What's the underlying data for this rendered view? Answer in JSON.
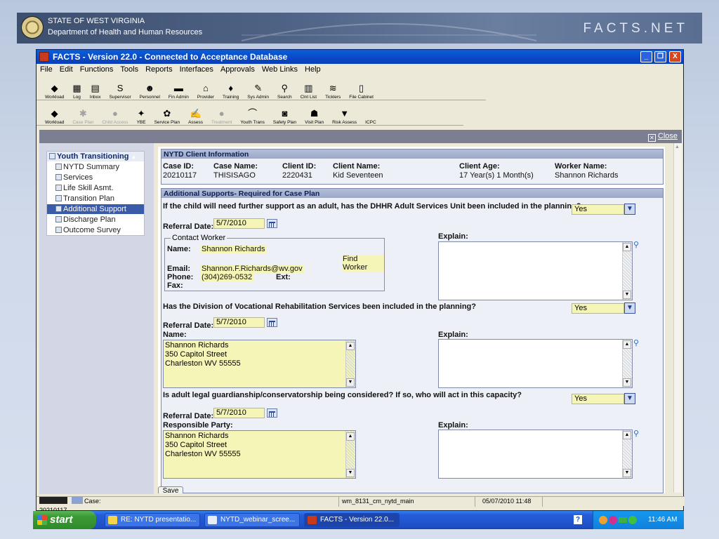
{
  "banner": {
    "line1": "STATE OF WEST VIRGINIA",
    "line2": "Department of Health and Human Resources",
    "brand": "FACTS.NET"
  },
  "window": {
    "title": "FACTS - Version 22.0 - Connected to Acceptance Database",
    "min": "_",
    "max": "❐",
    "close": "X"
  },
  "menu": [
    "File",
    "Edit",
    "Functions",
    "Tools",
    "Reports",
    "Interfaces",
    "Approvals",
    "Web Links",
    "Help"
  ],
  "toolbar1": [
    {
      "label": "Workload",
      "icon": "workload-icon",
      "glyph": "◆"
    },
    {
      "label": "Log",
      "icon": "log-icon",
      "glyph": "▦"
    },
    {
      "label": "Inbox",
      "icon": "inbox-icon",
      "glyph": "▤"
    },
    {
      "label": "Supervisor",
      "icon": "supervisor-icon",
      "glyph": "S"
    },
    {
      "label": "Personnel",
      "icon": "personnel-icon",
      "glyph": "☻"
    },
    {
      "label": "Fin Admin",
      "icon": "fin-admin-icon",
      "glyph": "▬"
    },
    {
      "label": "Provider",
      "icon": "provider-icon",
      "glyph": "⌂"
    },
    {
      "label": "Training",
      "icon": "training-icon",
      "glyph": "♦"
    },
    {
      "label": "Sys Admin",
      "icon": "sys-admin-icon",
      "glyph": "✎"
    },
    {
      "label": "Search",
      "icon": "search-icon",
      "glyph": "⚲"
    },
    {
      "label": "Clnt List",
      "icon": "client-list-icon",
      "glyph": "▥"
    },
    {
      "label": "Ticklers",
      "icon": "ticklers-icon",
      "glyph": "≋"
    },
    {
      "label": "File Cabinet",
      "icon": "file-cabinet-icon",
      "glyph": "▯"
    }
  ],
  "toolbar2": [
    {
      "label": "Workload",
      "icon": "workload-icon",
      "glyph": "◆",
      "disabled": false
    },
    {
      "label": "Case Plan",
      "icon": "case-plan-icon",
      "glyph": "✱",
      "disabled": true
    },
    {
      "label": "Child Access",
      "icon": "child-access-icon",
      "glyph": "●",
      "disabled": true
    },
    {
      "label": "YBE",
      "icon": "ybe-icon",
      "glyph": "✦",
      "disabled": false
    },
    {
      "label": "Service Plan",
      "icon": "service-plan-icon",
      "glyph": "✿",
      "disabled": false
    },
    {
      "label": "Assess",
      "icon": "assess-icon",
      "glyph": "✍",
      "disabled": false
    },
    {
      "label": "Treatment",
      "icon": "treatment-icon",
      "glyph": "●",
      "disabled": true
    },
    {
      "label": "Youth Trans",
      "icon": "youth-trans-icon",
      "glyph": "⌒",
      "disabled": false
    },
    {
      "label": "Safety Plan",
      "icon": "safety-plan-icon",
      "glyph": "◙",
      "disabled": false
    },
    {
      "label": "Visit Plan",
      "icon": "visit-plan-icon",
      "glyph": "☗",
      "disabled": false
    },
    {
      "label": "Risk Assess",
      "icon": "risk-assess-icon",
      "glyph": "▼",
      "disabled": false
    },
    {
      "label": "ICPC",
      "icon": "icpc-icon",
      "glyph": "",
      "disabled": false
    }
  ],
  "close_label": "Close",
  "tree": {
    "root": "Youth Transitioning",
    "items": [
      "NYTD Summary",
      "Services",
      "Life Skill Asmt.",
      "Transition Plan",
      "Additional Support",
      "Discharge Plan",
      "Outcome Survey"
    ],
    "selected_index": 4
  },
  "client_info": {
    "header": "NYTD Client Information",
    "case_id_label": "Case ID:",
    "case_id": "20210117",
    "case_name_label": "Case Name:",
    "case_name": "THISISAGO",
    "client_id_label": "Client ID:",
    "client_id": "2220431",
    "client_name_label": "Client Name:",
    "client_name": "Kid Seventeen",
    "client_age_label": "Client Age:",
    "client_age": "17 Year(s) 1 Month(s)",
    "worker_name_label": "Worker Name:",
    "worker_name": "Shannon Richards"
  },
  "supports": {
    "header": "Additional Supports- Required for Case Plan",
    "q1": "If the child will need further support as an adult, has the DHHR Adult Services Unit been included in the planning?",
    "q1_answer": "Yes",
    "referral_label": "Referral Date:",
    "q1_referral_date": "5/7/2010",
    "contact_legend": "Contact Worker",
    "name_label": "Name:",
    "contact_name": "Shannon Richards",
    "find_worker": "Find Worker",
    "email_label": "Email:",
    "contact_email": "Shannon.F.Richards@wv.gov",
    "phone_label": "Phone:",
    "contact_phone": "(304)269-0532",
    "ext_label": "Ext:",
    "fax_label": "Fax:",
    "explain_label": "Explain:",
    "q2": "Has the Division of Vocational Rehabilitation Services been included in the planning?",
    "q2_answer": "Yes",
    "q2_referral_date": "5/7/2010",
    "q2_name_label": "Name:",
    "q2_name_lines": [
      "Shannon Richards",
      "350 Capitol Street",
      "Charleston WV 55555"
    ],
    "q3": "Is adult legal guardianship/conservatorship being considered? If so, who will act in this capacity?",
    "q3_answer": "Yes",
    "q3_referral_date": "5/7/2010",
    "responsible_label": "Responsible Party:",
    "q3_party_lines": [
      "Shannon Richards",
      "350 Capitol Street",
      "Charleston WV 55555"
    ],
    "save_label": "Save"
  },
  "status": {
    "case": "Case: 20210117",
    "form": "wm_8131_cm_nytd_main",
    "datetime": "05/07/2010 11:48"
  },
  "taskbar": {
    "start": "start",
    "tasks": [
      "RE: NYTD presentatio...",
      "NYTD_webinar_scree...",
      "FACTS - Version 22.0..."
    ],
    "time": "11:46 AM"
  }
}
